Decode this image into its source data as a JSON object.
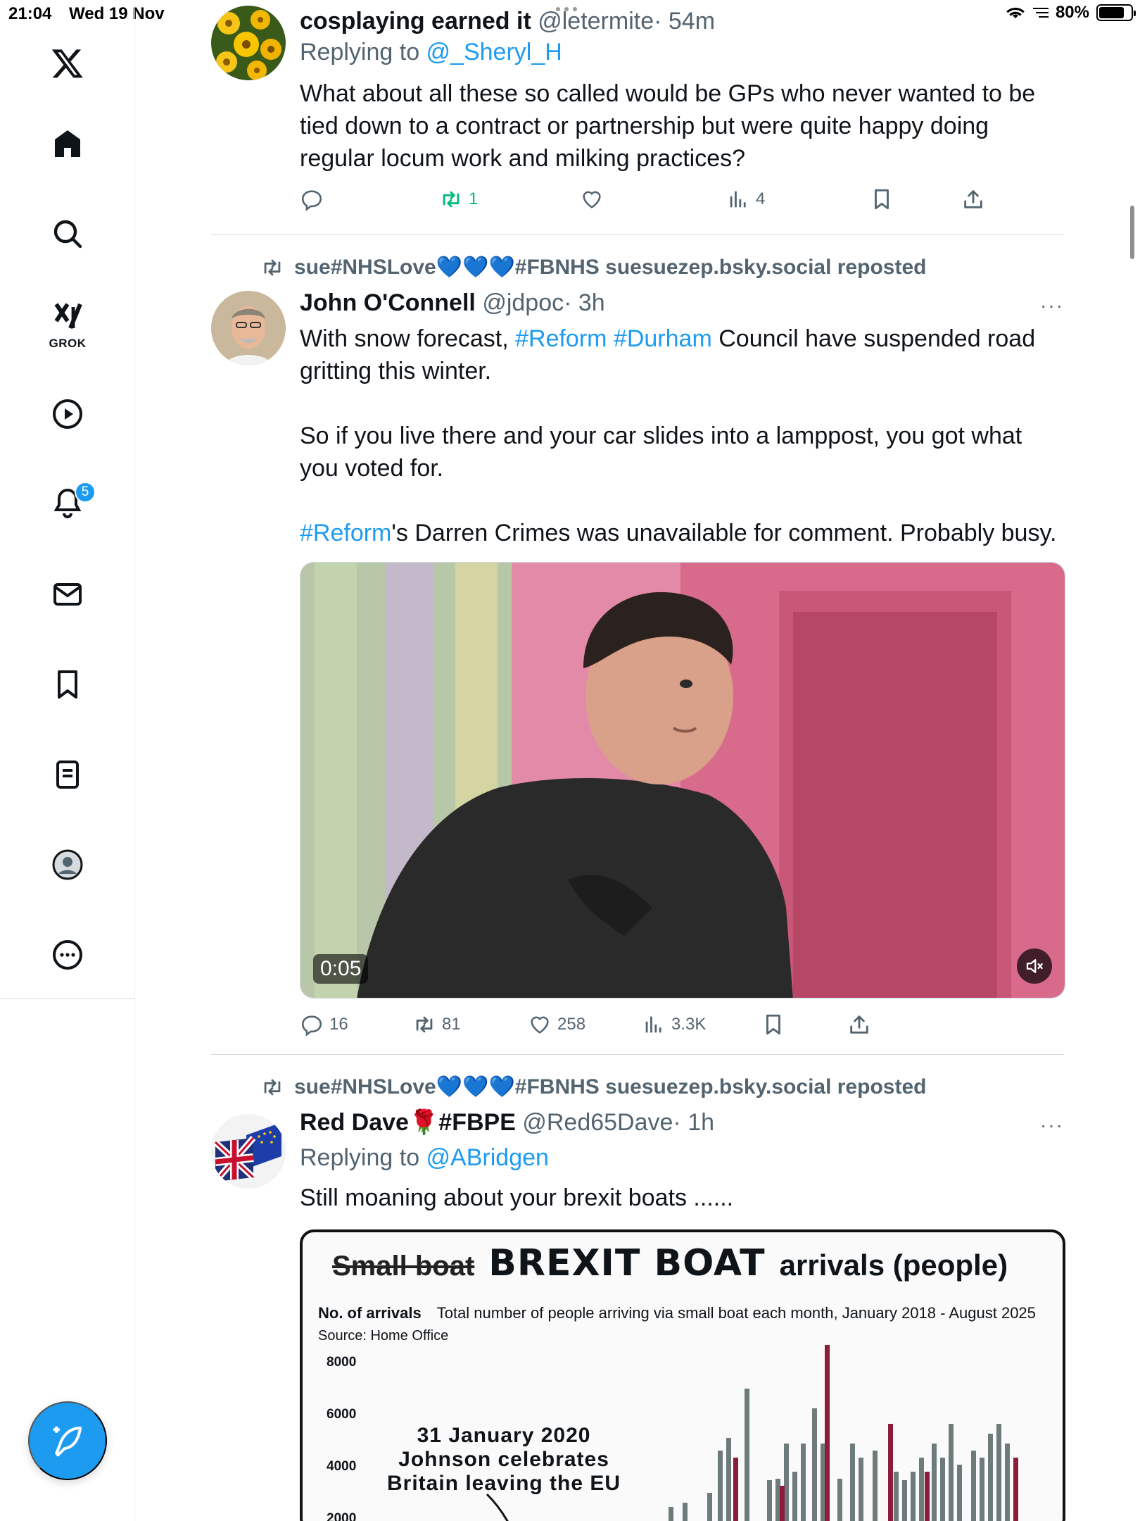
{
  "status_bar": {
    "time": "21:04",
    "date": "Wed 19 Nov",
    "battery": "80%"
  },
  "sidebar": {
    "items": [
      {
        "icon": "x-logo-icon"
      },
      {
        "icon": "home-icon"
      },
      {
        "icon": "search-icon"
      },
      {
        "icon": "grok-icon",
        "label": "GROK"
      },
      {
        "icon": "video-icon"
      },
      {
        "icon": "notifications-icon",
        "badge": "5"
      },
      {
        "icon": "messages-icon"
      },
      {
        "icon": "bookmarks-icon"
      },
      {
        "icon": "lists-icon"
      },
      {
        "icon": "profile-icon"
      },
      {
        "icon": "more-icon"
      }
    ],
    "compose_icon": "compose-icon"
  },
  "tweets": [
    {
      "name": "cosplaying earned it",
      "handle": "@letermite",
      "time": "· 54m",
      "reply_prefix": "Replying to ",
      "reply_to": "@_Sheryl_H",
      "text": "What about all these so called would be GPs who never wanted to be tied down to a contract or partnership but were quite happy doing regular locum work and milking practices?",
      "reposts": "1",
      "views": "4"
    },
    {
      "reposted_by": "sue#NHSLove💙💙💙#FBNHS suesuezep.bsky.social reposted",
      "name": "John O'Connell",
      "handle": "@jdpoc",
      "time": "· 3h",
      "text_1a": "With snow forecast, ",
      "tag_reform": "#Reform",
      "tag_durham": "#Durham",
      "text_1b": " Council have suspended road gritting this winter.",
      "text_2": "So if you live there and your car slides into a lamppost, you got what you voted for.",
      "text_3": "'s Darren Crimes was unavailable for comment. Probably busy.",
      "video_duration": "0:05",
      "replies": "16",
      "reposts": "81",
      "likes": "258",
      "views": "3.3K"
    },
    {
      "reposted_by": "sue#NHSLove💙💙💙#FBNHS suesuezep.bsky.social reposted",
      "name": "Red Dave🌹#FBPE",
      "handle": "@Red65Dave",
      "time": "· 1h",
      "reply_prefix": "Replying to ",
      "reply_to": "@ABridgen",
      "text": "Still moaning about your brexit boats ......",
      "chart_image": {
        "title_strike": "Small boat",
        "title_big": "BREXIT BOAT",
        "title_rest": "arrivals (people)",
        "label": "No. of arrivals",
        "subtitle": "Total number of people arriving via small boat each month, January 2018 - August 2025",
        "source": "Source: Home Office",
        "yticks": [
          "8000",
          "6000",
          "4000",
          "2000"
        ],
        "annotation_1": "31 January 2020",
        "annotation_2": "Johnson celebrates",
        "annotation_3": "Britain leaving the EU"
      }
    }
  ]
}
